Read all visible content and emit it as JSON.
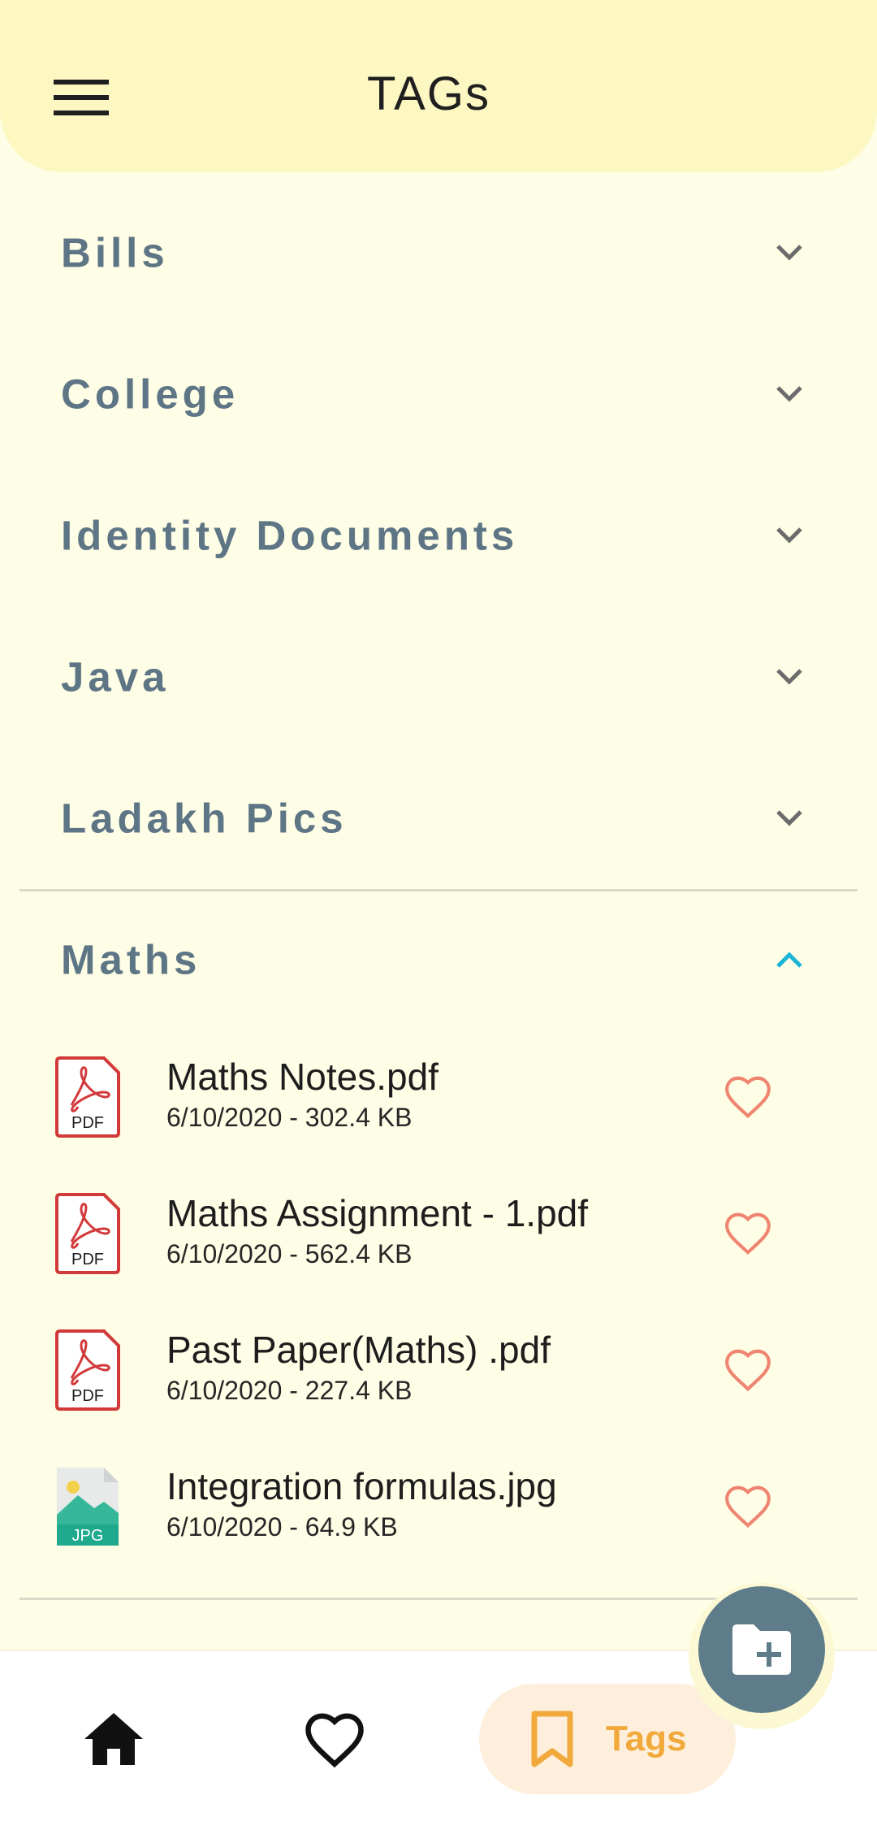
{
  "appbar": {
    "title": "TAGs"
  },
  "tags": [
    {
      "label": "Bills",
      "expanded": false
    },
    {
      "label": "College",
      "expanded": false
    },
    {
      "label": "Identity Documents",
      "expanded": false
    },
    {
      "label": "Java",
      "expanded": false
    },
    {
      "label": "Ladakh Pics",
      "expanded": false
    },
    {
      "label": "Maths",
      "expanded": true
    }
  ],
  "maths_files": [
    {
      "name": "Maths Notes.pdf",
      "meta": "6/10/2020 - 302.4 KB",
      "type": "PDF",
      "icon": "pdf-file-icon"
    },
    {
      "name": "Maths Assignment - 1.pdf",
      "meta": "6/10/2020 - 562.4 KB",
      "type": "PDF",
      "icon": "pdf-file-icon"
    },
    {
      "name": "Past Paper(Maths) .pdf",
      "meta": "6/10/2020 - 227.4 KB",
      "type": "PDF",
      "icon": "pdf-file-icon"
    },
    {
      "name": "Integration formulas.jpg",
      "meta": "6/10/2020 - 64.9 KB",
      "type": "JPG",
      "icon": "jpg-file-icon"
    }
  ],
  "fab": {
    "icon": "folder-add-icon"
  },
  "bottom_nav": {
    "home_icon": "home-icon",
    "favorites_icon": "heart-icon",
    "tags_icon": "bookmark-icon",
    "tags_label": "Tags",
    "active": "Tags"
  },
  "colors": {
    "background": "#fefde6",
    "appbar": "#fdf8c2",
    "tag_label": "#5d7585",
    "expanded_chevron": "#1ab4d6",
    "favorite_heart": "#ef8570",
    "fab": "#5f7c8a",
    "active_nav_bg": "#fdefdc",
    "active_nav_fg": "#f2a93b"
  }
}
